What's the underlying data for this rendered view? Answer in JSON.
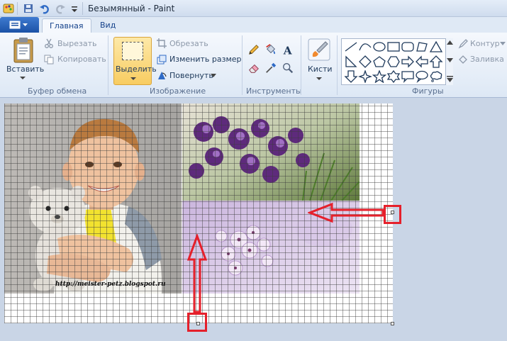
{
  "window": {
    "title": "Безымянный - Paint"
  },
  "tabs": [
    {
      "label": "Главная",
      "active": true
    },
    {
      "label": "Вид",
      "active": false
    }
  ],
  "clipboard": {
    "paste_label": "Вставить",
    "cut_label": "Вырезать",
    "copy_label": "Копировать",
    "group_label": "Буфер обмена"
  },
  "image": {
    "select_label": "Выделить",
    "crop_label": "Обрезать",
    "resize_label": "Изменить размер",
    "rotate_label": "Повернуть",
    "group_label": "Изображение"
  },
  "tools": {
    "group_label": "Инструменты"
  },
  "brushes": {
    "label": "Кисти"
  },
  "shapes": {
    "group_label": "Фигуры",
    "outline_label": "Контур",
    "fill_label": "Заливка"
  },
  "canvas": {
    "watermark": "http://meister-petz.blogspot.ru"
  },
  "colors": {
    "accent_red": "#e5202b",
    "ribbon_bg": "#f5f8fd",
    "select_highlight": "#f8cc61",
    "file_button": "#1b52a6"
  }
}
